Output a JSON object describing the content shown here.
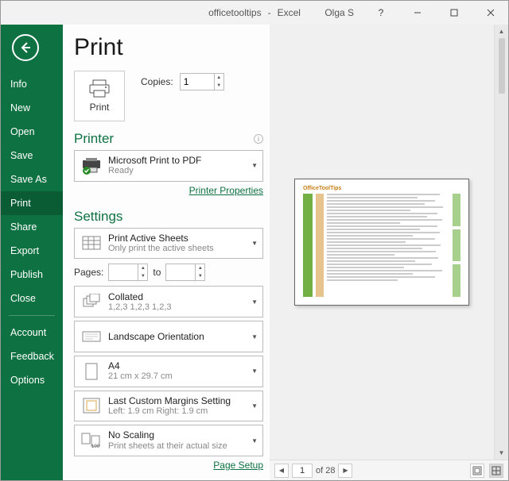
{
  "titlebar": {
    "docname": "officetooltips",
    "appname": "Excel",
    "username": "Olga S"
  },
  "sidebar": {
    "items": [
      {
        "label": "Info"
      },
      {
        "label": "New"
      },
      {
        "label": "Open"
      },
      {
        "label": "Save"
      },
      {
        "label": "Save As"
      },
      {
        "label": "Print"
      },
      {
        "label": "Share"
      },
      {
        "label": "Export"
      },
      {
        "label": "Publish"
      },
      {
        "label": "Close"
      }
    ],
    "bottom": [
      {
        "label": "Account"
      },
      {
        "label": "Feedback"
      },
      {
        "label": "Options"
      }
    ]
  },
  "page": {
    "title": "Print",
    "print_button": "Print",
    "copies_label": "Copies:",
    "copies_value": "1"
  },
  "printer": {
    "section": "Printer",
    "name": "Microsoft Print to PDF",
    "status": "Ready",
    "props_link": "Printer Properties"
  },
  "settings": {
    "section": "Settings",
    "what": {
      "line1": "Print Active Sheets",
      "line2": "Only print the active sheets"
    },
    "pages_label": "Pages:",
    "pages_to": "to",
    "pages_from": "",
    "pages_to_val": "",
    "collate": {
      "line1": "Collated",
      "line2": "1,2,3    1,2,3    1,2,3"
    },
    "orientation": {
      "line1": "Landscape Orientation",
      "line2": ""
    },
    "paper": {
      "line1": "A4",
      "line2": "21 cm x 29.7 cm"
    },
    "margins": {
      "line1": "Last Custom Margins Setting",
      "line2": "Left:  1.9 cm     Right:  1.9 cm"
    },
    "scaling": {
      "line1": "No Scaling",
      "line2": "Print sheets at their actual size"
    },
    "page_setup_link": "Page Setup"
  },
  "preview": {
    "page_current": "1",
    "page_total": "of 28",
    "doc_title": "OfficeToolTips"
  },
  "colors": {
    "accent": "#0e7141"
  }
}
